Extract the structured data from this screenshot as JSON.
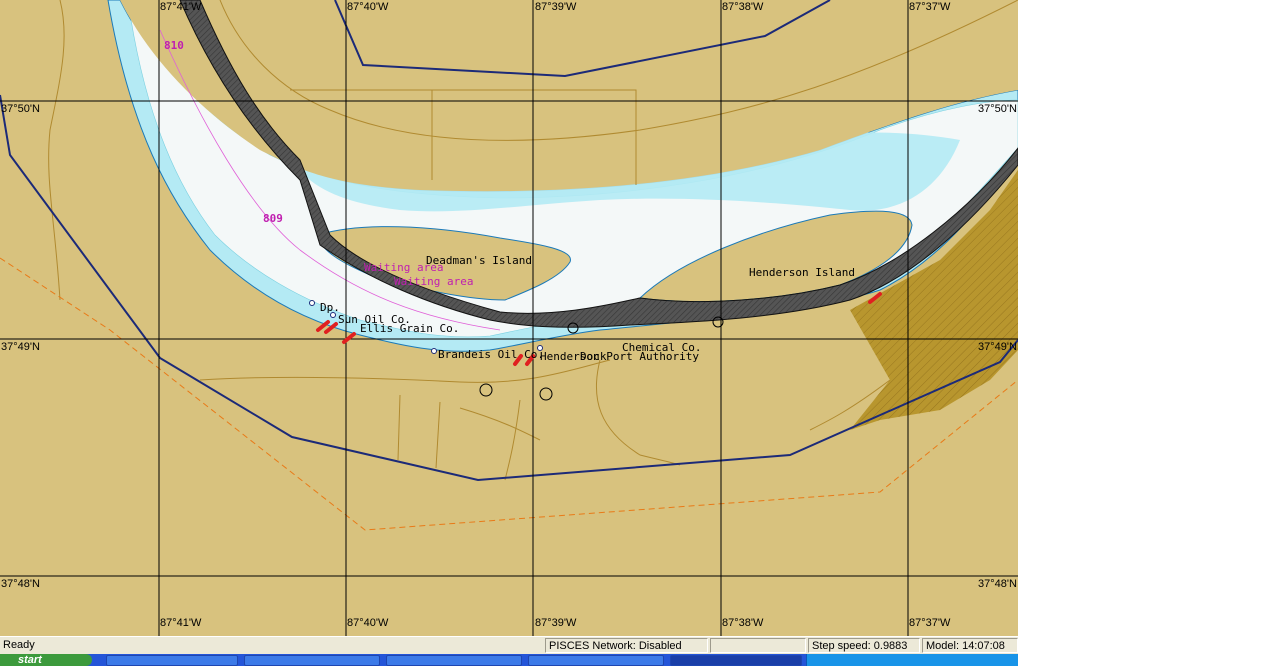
{
  "map": {
    "longitude_labels_top": [
      "87°41'W",
      "87°40'W",
      "87°39'W",
      "87°38'W",
      "87°37'W"
    ],
    "longitude_labels_bottom": [
      "87°41'W",
      "87°40'W",
      "87°39'W",
      "87°38'W",
      "87°37'W"
    ],
    "latitude_labels_left": [
      "37°50'N",
      "37°49'N",
      "37°48'N"
    ],
    "latitude_labels_right": [
      "37°50'N",
      "37°49'N",
      "37°48'N"
    ],
    "river_miles": [
      "810",
      "809"
    ],
    "islands": [
      "Deadman's Island",
      "Henderson Island"
    ],
    "areas": [
      "Waiting area",
      "Waiting area"
    ],
    "facilities": [
      "Sun Oil Co.",
      "Ellis Grain Co.",
      "Dp.",
      "Brandeis Oil Co.",
      "Chemical Co.",
      "Henderson Port Authority",
      "Dock"
    ],
    "colors": {
      "land": "#d8c27e",
      "water_shallow": "#b4eaf4",
      "water_deep": "#f4f8f8",
      "grid": "#000000",
      "boundary": "#1c2a78",
      "river_mile": "#c020b0",
      "hatched": "#a88a2c"
    }
  },
  "status": {
    "ready": "Ready",
    "network": "PISCES Network: Disabled",
    "step_speed": "Step speed: 0.9883",
    "model_time": "Model: 14:07:08"
  },
  "taskbar": {
    "start_label": "start"
  }
}
